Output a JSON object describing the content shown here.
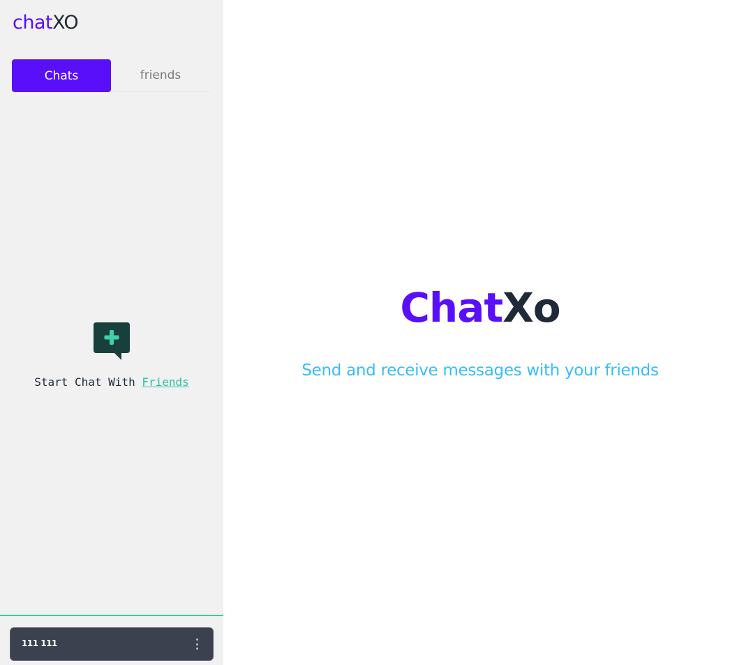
{
  "sidebar": {
    "logo": {
      "part1": "chat",
      "part2": "XO"
    },
    "tabs": [
      {
        "label": "Chats",
        "active": true
      },
      {
        "label": "friends",
        "active": false
      }
    ],
    "empty_state": {
      "icon": "chat-add-icon",
      "prefix": "Start Chat With",
      "link": "Friends"
    },
    "user": {
      "name": "111 111",
      "menu_icon": "kebab-menu-icon"
    }
  },
  "main": {
    "title_part1": "Chat",
    "title_part2": "Xo",
    "subtitle": "Send and receive messages with your friends"
  },
  "colors": {
    "brand": "#5a0ffa",
    "dark": "#1f2937",
    "accent": "#2bbfa0",
    "subtitle": "#38bdf8",
    "footer_border": "#34d399",
    "user_card": "#3b414f"
  }
}
